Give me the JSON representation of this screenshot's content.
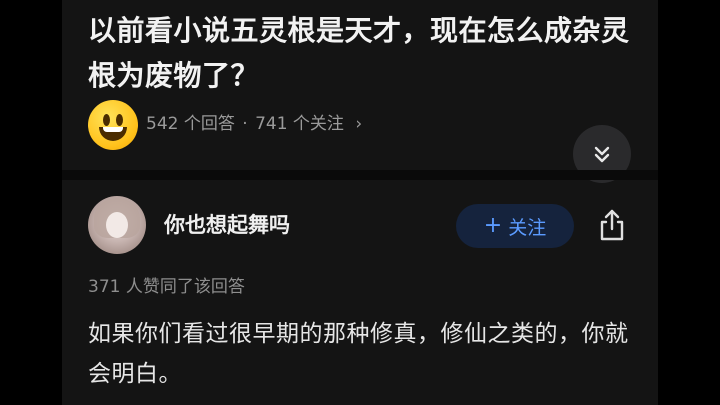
{
  "question": {
    "title": "以前看小说五灵根是天才，现在怎么成杂灵根为废物了？",
    "answers_count": "542 个回答",
    "separator": "·",
    "followers_count": "741 个关注",
    "chevron": "›"
  },
  "expand_button": {
    "icon": "chevron-double-down-icon"
  },
  "answer": {
    "author_name": "你也想起舞吗",
    "follow_label": "关注",
    "follow_plus": "+",
    "likes_text": "371 人赞同了该回答",
    "body": "如果你们看过很早期的那种修真，修仙之类的，你就会明白。"
  },
  "colors": {
    "background": "#141414",
    "accent": "#5b9bff",
    "follow_bg": "#15233d"
  }
}
